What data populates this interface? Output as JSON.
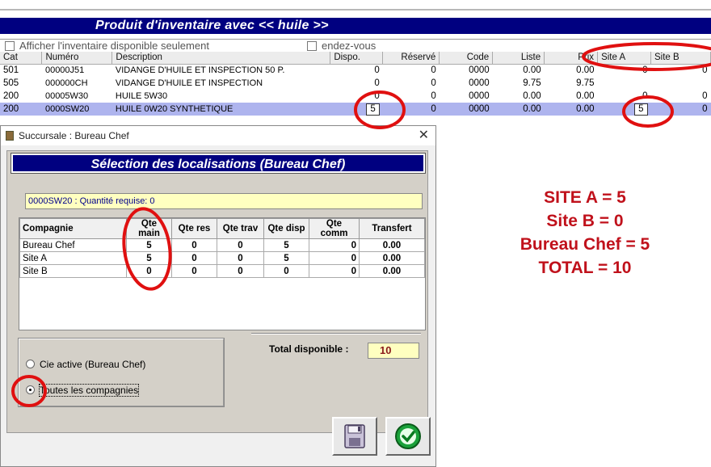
{
  "window": {
    "title": "Produit d'inventaire avec << huile >>"
  },
  "filter": {
    "available_only_label": "Afficher l'inventaire disponible seulement",
    "appointments_label": "endez-vous"
  },
  "inventory": {
    "columns": [
      "Cat",
      "Numéro",
      "Description",
      "Dispo.",
      "Réservé",
      "Code",
      "Liste",
      "Prix",
      "Site A",
      "Site B"
    ],
    "rows": [
      {
        "cat": "501",
        "numero": "00000J51",
        "desc": "VIDANGE D'HUILE ET INSPECTION 50 P.",
        "dispo": "0",
        "reserve": "0",
        "code": "0000",
        "liste": "0.00",
        "prix": "0.00",
        "site_a": "0",
        "site_b": "0"
      },
      {
        "cat": "505",
        "numero": "000000CH",
        "desc": "VIDANGE D'HUILE ET INSPECTION",
        "dispo": "0",
        "reserve": "0",
        "code": "0000",
        "liste": "9.75",
        "prix": "9.75",
        "site_a": "",
        "site_b": ""
      },
      {
        "cat": "200",
        "numero": "00005W30",
        "desc": "HUILE 5W30",
        "dispo": "0",
        "reserve": "0",
        "code": "0000",
        "liste": "0.00",
        "prix": "0.00",
        "site_a": "0",
        "site_b": "0"
      },
      {
        "cat": "200",
        "numero": "0000SW20",
        "desc": "HUILE 0W20 SYNTHETIQUE",
        "dispo": "5",
        "reserve": "0",
        "code": "0000",
        "liste": "0.00",
        "prix": "0.00",
        "site_a": "5",
        "site_b": "0"
      }
    ]
  },
  "dialog": {
    "titlebar": "Succursale : Bureau Chef",
    "close_glyph": "✕",
    "header": "Sélection des localisations (Bureau Chef)",
    "qty_field": "0000SW20 : Quantité requise: 0",
    "columns": [
      "Compagnie",
      "Qte main",
      "Qte res",
      "Qte trav",
      "Qte disp",
      "Qte comm",
      "Transfert"
    ],
    "rows": [
      {
        "company": "Bureau Chef",
        "main": "5",
        "res": "0",
        "trav": "0",
        "disp": "5",
        "comm": "0",
        "transfert": "0.00"
      },
      {
        "company": "Site A",
        "main": "5",
        "res": "0",
        "trav": "0",
        "disp": "5",
        "comm": "0",
        "transfert": "0.00"
      },
      {
        "company": "Site B",
        "main": "0",
        "res": "0",
        "trav": "0",
        "disp": "0",
        "comm": "0",
        "transfert": "0.00"
      }
    ],
    "radio_active": "Cie active (Bureau Chef)",
    "radio_all": "Toutes les compagnies",
    "radio_selected": "all",
    "total_label": "Total disponible :",
    "total_value": "10",
    "save_icon": "floppy-disk-icon",
    "ok_icon": "green-check-icon"
  },
  "note": {
    "lines": [
      "SITE A = 5",
      "Site B = 0",
      "Bureau Chef = 5",
      "TOTAL = 10"
    ],
    "color": "#c0111b"
  },
  "colors": {
    "title_bar": "#000080",
    "selected_row": "#aeb4ee",
    "yellow_field": "#ffffc0",
    "annotation_red": "#e01010"
  }
}
